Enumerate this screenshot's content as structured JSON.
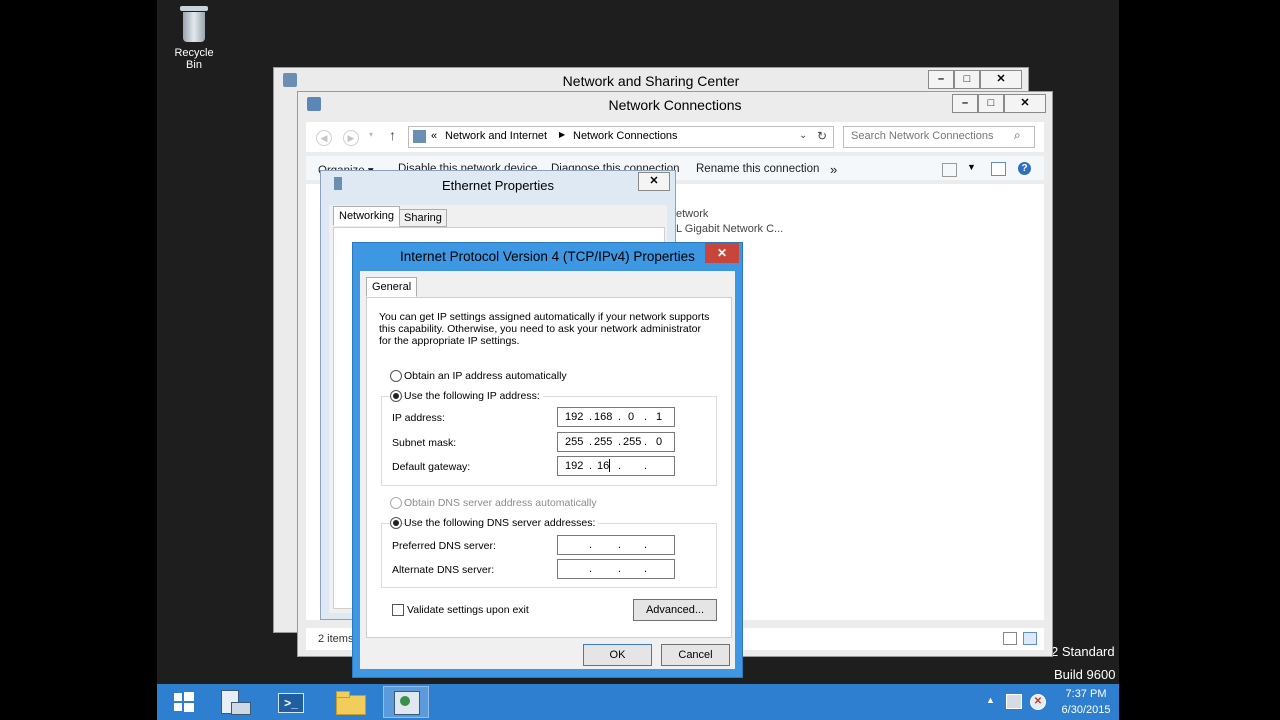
{
  "desktop": {
    "recycle_bin_label": "Recycle Bin",
    "watermark_line1": "2 Standard",
    "watermark_line2": "Build 9600"
  },
  "nsc_window": {
    "title": "Network and Sharing Center",
    "minimize": "–",
    "maximize": "□",
    "close": "✕"
  },
  "nc_window": {
    "title": "Network Connections",
    "minimize": "–",
    "maximize": "□",
    "close": "✕",
    "breadcrumb_sep": "«",
    "breadcrumb": [
      "Network and Internet",
      "Network Connections"
    ],
    "search_placeholder": "Search Network Connections",
    "toolbar": {
      "organize": "Organize ▾",
      "disable": "Disable this network device",
      "diagnose": "Diagnose this connection",
      "rename": "Rename this connection",
      "more": "»"
    },
    "connection": {
      "line1": "etwork",
      "line2": "L Gigabit Network C..."
    },
    "status": "2 items"
  },
  "ethernet_props": {
    "title": "Ethernet Properties",
    "close": "✕",
    "tabs": [
      "Networking",
      "Sharing"
    ]
  },
  "ipv4_dialog": {
    "title": "Internet Protocol Version 4 (TCP/IPv4) Properties",
    "close": "✕",
    "tab": "General",
    "description": [
      "You can get IP settings assigned automatically if your network supports",
      "this capability. Otherwise, you need to ask your network administrator",
      "for the appropriate IP settings."
    ],
    "radio_auto_ip": "Obtain an IP address automatically",
    "radio_manual_ip": "Use the following IP address:",
    "ip_label": "IP address:",
    "ip_value": [
      "192",
      "168",
      "0",
      "1"
    ],
    "subnet_label": "Subnet mask:",
    "subnet_value": [
      "255",
      "255",
      "255",
      "0"
    ],
    "gateway_label": "Default gateway:",
    "gateway_value": [
      "192",
      "16",
      "",
      ""
    ],
    "radio_auto_dns": "Obtain DNS server address automatically",
    "radio_manual_dns": "Use the following DNS server addresses:",
    "preferred_dns_label": "Preferred DNS server:",
    "alternate_dns_label": "Alternate DNS server:",
    "validate_label": "Validate settings upon exit",
    "advanced_button": "Advanced...",
    "ok_button": "OK",
    "cancel_button": "Cancel"
  },
  "taskbar": {
    "time": "7:37 PM",
    "date": "6/30/2015",
    "tray_arrow": "▲"
  },
  "colors": {
    "taskbar": "#2f7fd1",
    "dialog_frame": "#3d97e3",
    "close_red": "#c7453a"
  }
}
